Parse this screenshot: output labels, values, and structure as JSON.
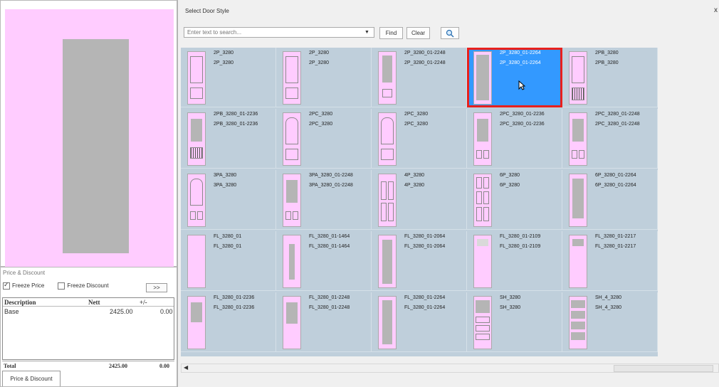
{
  "window_title": "Select Door Style",
  "close_glyph": "x",
  "search": {
    "placeholder": "Enter text to search...",
    "find_label": "Find",
    "clear_label": "Clear"
  },
  "price_panel": {
    "title": "Price & Discount",
    "freeze_price_label": "Freeze Price",
    "freeze_price_checked": true,
    "freeze_discount_label": "Freeze Discount",
    "freeze_discount_checked": false,
    "expand_label": ">>",
    "columns": [
      "Description",
      "Nett",
      "+/-"
    ],
    "rows": [
      {
        "description": "Base",
        "nett": "2425.00",
        "diff": "0.00"
      }
    ],
    "total": {
      "label": "Total",
      "nett": "2425.00",
      "diff": "0.00"
    },
    "tab_label": "Price & Discount"
  },
  "tiles": [
    {
      "name": "2P_3280",
      "thumb": "2p"
    },
    {
      "name": "2P_3280",
      "thumb": "2p-b"
    },
    {
      "name": "2P_3280_01-2248",
      "thumb": "solid-bot"
    },
    {
      "name": "2P_3280_01-2264",
      "thumb": "full",
      "selected": true
    },
    {
      "name": "2PB_3280",
      "thumb": "2pb"
    },
    {
      "name": "2PB_3280_01-2236",
      "thumb": "2pb-g"
    },
    {
      "name": "2PC_3280",
      "thumb": "2pc"
    },
    {
      "name": "2PC_3280",
      "thumb": "2pc-b"
    },
    {
      "name": "2PC_3280_01-2236",
      "thumb": "2pc-g"
    },
    {
      "name": "2PC_3280_01-2248",
      "thumb": "2pc-g2"
    },
    {
      "name": "3PA_3280",
      "thumb": "3pa"
    },
    {
      "name": "3PA_3280_01-2248",
      "thumb": "3pa-g"
    },
    {
      "name": "4P_3280",
      "thumb": "4p"
    },
    {
      "name": "6P_3280",
      "thumb": "6p"
    },
    {
      "name": "6P_3280_01-2264",
      "thumb": "6p-g"
    },
    {
      "name": "FL_3280_01",
      "thumb": "plain"
    },
    {
      "name": "FL_3280_01-1464",
      "thumb": "fl-1464"
    },
    {
      "name": "FL_3280_01-2064",
      "thumb": "fl-2064"
    },
    {
      "name": "FL_3280_01-2109",
      "thumb": "fl-2109"
    },
    {
      "name": "FL_3280_01-2217",
      "thumb": "fl-2217"
    },
    {
      "name": "FL_3280_01-2236",
      "thumb": "fl-2236"
    },
    {
      "name": "FL_3280_01-2248",
      "thumb": "fl-2248"
    },
    {
      "name": "FL_3280_01-2264",
      "thumb": "fl-2264"
    },
    {
      "name": "SH_3280",
      "thumb": "sh"
    },
    {
      "name": "SH_4_3280",
      "thumb": "sh4"
    }
  ],
  "colors": {
    "gallery_bg": "#bfcfdb",
    "door_pink": "#ffccff",
    "glass_gray": "#b5b5b5",
    "selected_bg": "#3399ff",
    "selection_border": "#e8201c"
  }
}
